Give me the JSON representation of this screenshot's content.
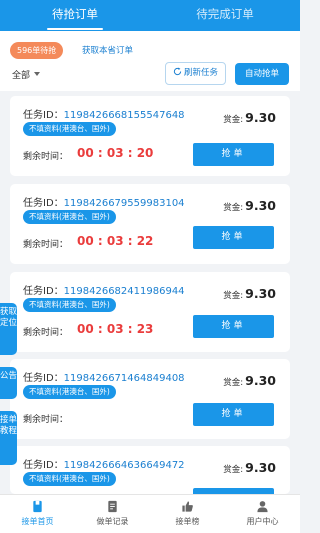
{
  "tabs": [
    {
      "label": "待抢订单",
      "active": true
    },
    {
      "label": "待完成订单",
      "active": false
    }
  ],
  "subbar": {
    "wait_badge": "596单待抢",
    "mine_link": "获取本省订单",
    "filter_label": "全部",
    "refresh_label": "刷新任务",
    "auto_label": "自动抢单"
  },
  "cards": [
    {
      "task_label": "任务ID：",
      "task_id": "1198426668155547648",
      "tag": "不填资料(港澳台、国外)",
      "reward_label": "赏金:",
      "reward": "9.30",
      "remain_label": "剩余时间：",
      "remain": "00 : 03 : 20",
      "button": "抢单"
    },
    {
      "task_label": "任务ID：",
      "task_id": "1198426679559983104",
      "tag": "不填资料(港澳台、国外)",
      "reward_label": "赏金:",
      "reward": "9.30",
      "remain_label": "剩余时间：",
      "remain": "00 : 03 : 22",
      "button": "抢单"
    },
    {
      "task_label": "任务ID：",
      "task_id": "1198426682411986944",
      "tag": "不填资料(港澳台、国外)",
      "reward_label": "赏金:",
      "reward": "9.30",
      "remain_label": "剩余时间：",
      "remain": "00 : 03 : 23",
      "button": "抢单"
    },
    {
      "task_label": "任务ID：",
      "task_id": "1198426671464849408",
      "tag": "不填资料(港澳台、国外)",
      "reward_label": "赏金:",
      "reward": "9.30",
      "remain_label": "剩余时间：",
      "remain": "",
      "button": "抢单"
    },
    {
      "task_label": "任务ID：",
      "task_id": "1198426664636649472",
      "tag": "不填资料(港澳台、国外)",
      "reward_label": "赏金:",
      "reward": "9.30",
      "remain_label": "",
      "remain": "",
      "button": ""
    }
  ],
  "side_tabs": [
    {
      "label": "获取定位"
    },
    {
      "label": "公告"
    },
    {
      "label": "接单教程"
    }
  ],
  "bottom_nav": [
    {
      "label": "接单首页",
      "icon": "home-icon",
      "active": true
    },
    {
      "label": "做单记录",
      "icon": "record-icon",
      "active": false
    },
    {
      "label": "接单榜",
      "icon": "thumbs-up-icon",
      "active": false
    },
    {
      "label": "用户中心",
      "icon": "user-icon",
      "active": false
    }
  ],
  "colors": {
    "accent": "#1a96e8",
    "badge": "#f48a5a",
    "countdown": "#ea3c3c"
  }
}
